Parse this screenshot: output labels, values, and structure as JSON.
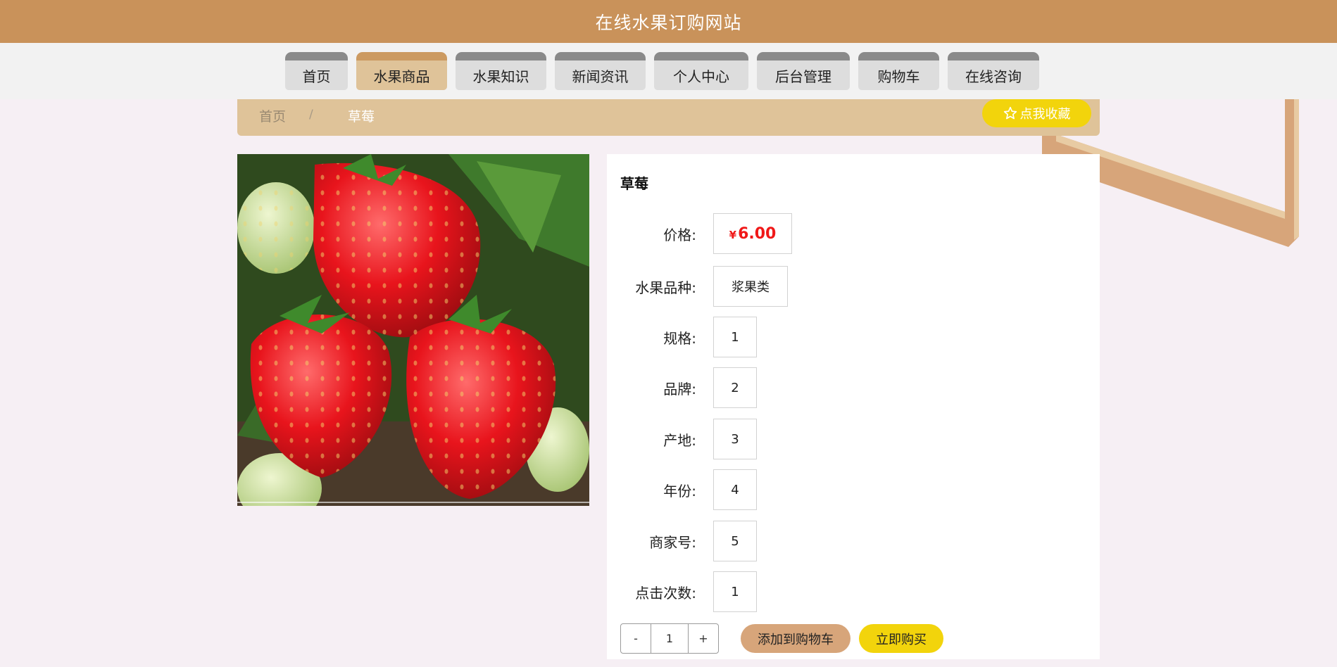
{
  "header": {
    "title": "在线水果订购网站"
  },
  "nav": {
    "items": [
      {
        "label": "首页"
      },
      {
        "label": "水果商品"
      },
      {
        "label": "水果知识"
      },
      {
        "label": "新闻资讯"
      },
      {
        "label": "个人中心"
      },
      {
        "label": "后台管理"
      },
      {
        "label": "购物车"
      },
      {
        "label": "在线咨询"
      }
    ],
    "active_index": 1
  },
  "breadcrumb": {
    "home": "首页",
    "separator": "/",
    "current": "草莓"
  },
  "favorite": {
    "icon": "star-outline-icon",
    "label": "点我收藏"
  },
  "product": {
    "name": "草莓",
    "price_symbol": "¥",
    "price": "6.00",
    "fields": [
      {
        "label": "价格:"
      },
      {
        "label": "水果品种:",
        "value": "浆果类"
      },
      {
        "label": "规格:",
        "value": "1"
      },
      {
        "label": "品牌:",
        "value": "2"
      },
      {
        "label": "产地:",
        "value": "3"
      },
      {
        "label": "年份:",
        "value": "4"
      },
      {
        "label": "商家号:",
        "value": "5"
      },
      {
        "label": "点击次数:",
        "value": "1"
      }
    ]
  },
  "quantity": {
    "minus": "-",
    "value": "1",
    "plus": "+"
  },
  "actions": {
    "add_to_cart": "添加到购物车",
    "buy_now": "立即购买"
  },
  "colors": {
    "header": "#c9925a",
    "accent_light": "#dfc399",
    "yellow": "#f2d40c",
    "price": "#f01818",
    "cart_button": "#d7a57a"
  }
}
